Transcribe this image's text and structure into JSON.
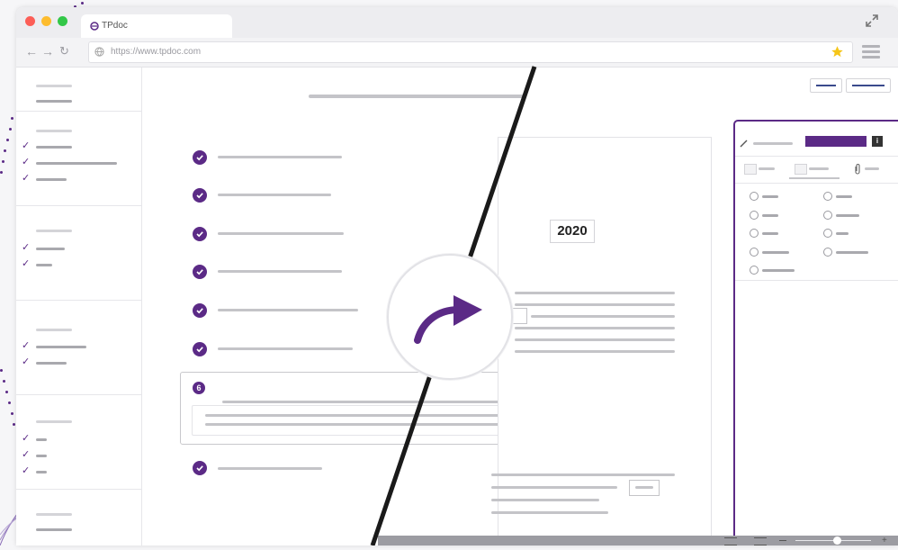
{
  "browser": {
    "tab_title": "TPdoc",
    "url": "https://www.tpdoc.com"
  },
  "document": {
    "year": "2020",
    "active_step_number": "6"
  },
  "colors": {
    "accent": "#5b2a86",
    "favorite_star": "#f5c518",
    "window_red": "#fc5e57",
    "window_yellow": "#fdbc2e",
    "window_green": "#33c748"
  },
  "icons": {
    "fullscreen": "expand-arrows-icon",
    "favorite": "star-icon",
    "menu": "hamburger-menu-icon",
    "convert": "curved-arrow-icon",
    "info": "info-icon",
    "paperclip": "paperclip-icon",
    "pen": "pen-icon"
  }
}
